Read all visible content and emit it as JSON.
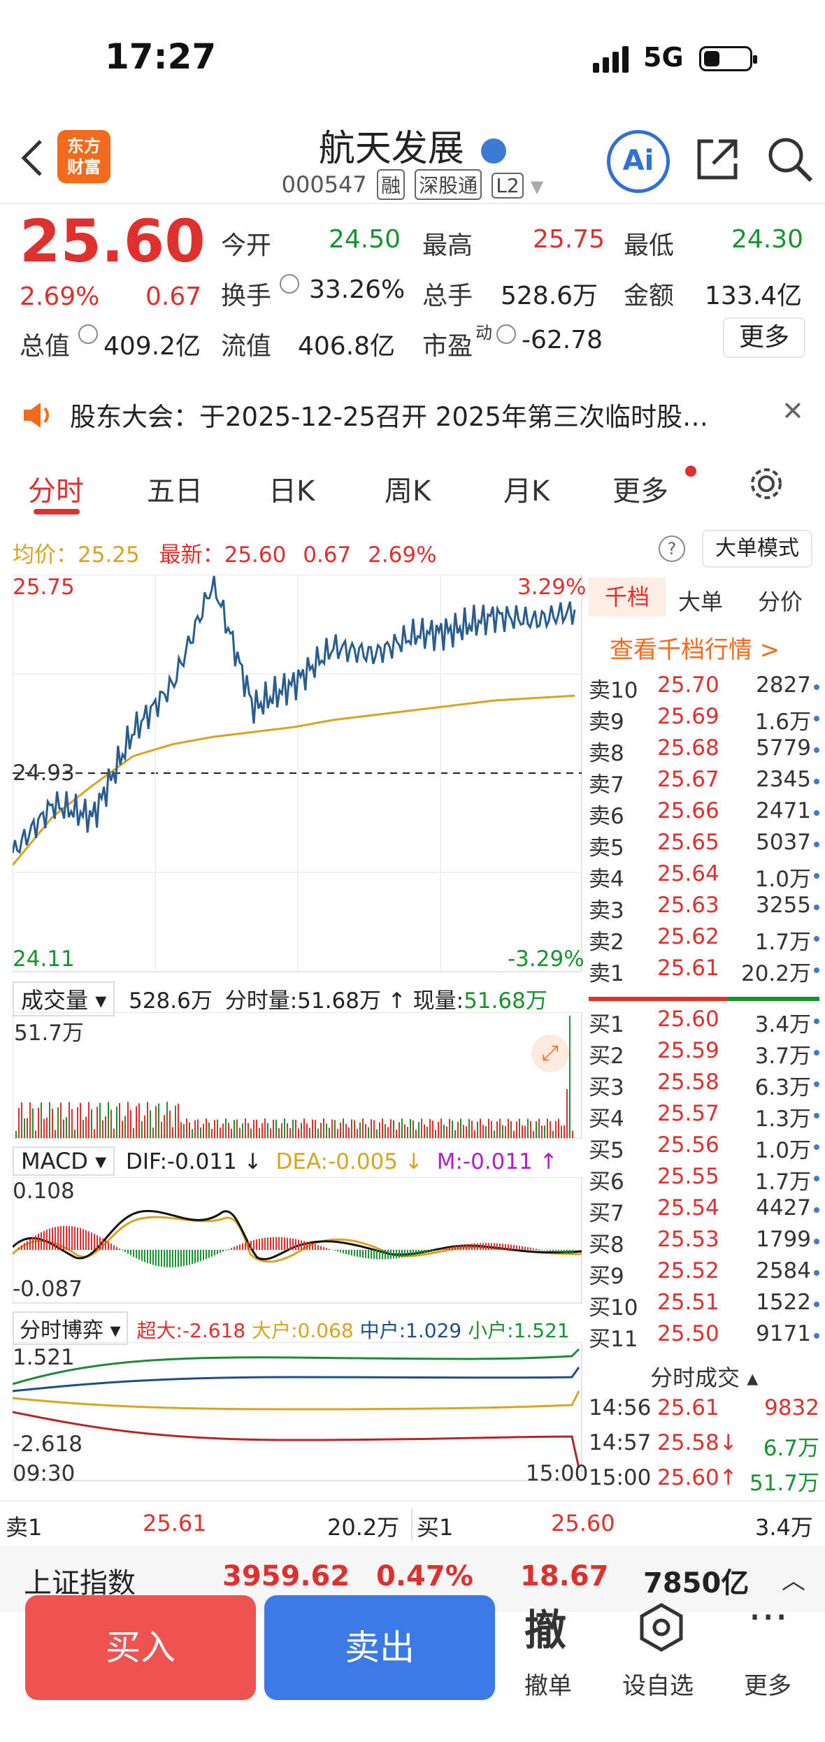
{
  "status": {
    "time": "17:27",
    "network": "5G"
  },
  "header": {
    "logo_line1": "东方",
    "logo_line2": "财富",
    "stock_name": "航天发展",
    "stock_code": "000547",
    "tags": [
      "融",
      "深股通",
      "L2"
    ],
    "ai_label": "Ai"
  },
  "quote": {
    "price": "25.60",
    "change_pct": "2.69%",
    "change": "0.67",
    "open_label": "今开",
    "open": "24.50",
    "high_label": "最高",
    "high": "25.75",
    "low_label": "最低",
    "low": "24.30",
    "turnover_label": "换手",
    "turnover": "33.26%",
    "volume_label": "总手",
    "volume": "528.6万",
    "amount_label": "金额",
    "amount": "133.4亿",
    "mktcap_label": "总值",
    "mktcap": "409.2亿",
    "float_label": "流值",
    "float_cap": "406.8亿",
    "pe_label": "市盈",
    "pe_sup": "动",
    "pe": "-62.78",
    "more_label": "更多"
  },
  "notice": {
    "text": "股东大会：于2025-12-25召开 2025年第三次临时股…"
  },
  "tabs": [
    "分时",
    "五日",
    "日K",
    "周K",
    "月K",
    "更多"
  ],
  "avg_line": {
    "avg_label": "均价：",
    "avg": "25.25",
    "latest_label": "最新：",
    "latest": "25.60",
    "latest_change": "0.67",
    "latest_pct": "2.69%",
    "big_order_mode": "大单模式"
  },
  "chart": {
    "y_top": "25.75",
    "y_mid": "24.93",
    "y_bottom": "24.11",
    "pct_top": "3.29%",
    "pct_bottom": "-3.29%",
    "volume_label": "成交量",
    "volume_total": "528.6万",
    "volume_time_label": "分时量:",
    "volume_time": "51.68万",
    "volume_now_label": "现量:",
    "volume_now": "51.68万",
    "volume_max": "51.7万",
    "macd_label": "MACD",
    "dif": "DIF:-0.011 ↓",
    "dea": "DEA:-0.005 ↓",
    "m": "M:-0.011 ↑",
    "macd_top": "0.108",
    "macd_bottom": "-0.087",
    "game_label": "分时博弈",
    "super": "超大:-2.618",
    "big": "大户:0.068",
    "mid": "中户:1.029",
    "small": "小户:1.521",
    "game_top": "1.521",
    "game_bottom": "-2.618",
    "time_start": "09:30",
    "time_end": "15:00"
  },
  "chart_data": {
    "type": "line",
    "title": "",
    "x": [
      "09:30",
      "15:00"
    ],
    "series": [
      {
        "name": "最新",
        "values": [
          24.6,
          24.8,
          24.75,
          25.1,
          25.3,
          25.72,
          25.2,
          25.3,
          25.45,
          25.42,
          25.5,
          25.52,
          25.58,
          25.56,
          25.6
        ]
      },
      {
        "name": "均价",
        "values": [
          24.55,
          24.75,
          24.88,
          25.0,
          25.05,
          25.08,
          25.1,
          25.12,
          25.15,
          25.17,
          25.19,
          25.21,
          25.23,
          25.24,
          25.25
        ]
      }
    ],
    "ylim": [
      24.11,
      25.75
    ]
  },
  "orderbook": {
    "tabs": [
      "千档",
      "大单",
      "分价"
    ],
    "link": "查看千档行情 >",
    "asks": [
      {
        "label": "卖10",
        "price": "25.70",
        "vol": "2827"
      },
      {
        "label": "卖9",
        "price": "25.69",
        "vol": "1.6万"
      },
      {
        "label": "卖8",
        "price": "25.68",
        "vol": "5779"
      },
      {
        "label": "卖7",
        "price": "25.67",
        "vol": "2345"
      },
      {
        "label": "卖6",
        "price": "25.66",
        "vol": "2471"
      },
      {
        "label": "卖5",
        "price": "25.65",
        "vol": "5037"
      },
      {
        "label": "卖4",
        "price": "25.64",
        "vol": "1.0万"
      },
      {
        "label": "卖3",
        "price": "25.63",
        "vol": "3255"
      },
      {
        "label": "卖2",
        "price": "25.62",
        "vol": "1.7万"
      },
      {
        "label": "卖1",
        "price": "25.61",
        "vol": "20.2万"
      }
    ],
    "bids": [
      {
        "label": "买1",
        "price": "25.60",
        "vol": "3.4万"
      },
      {
        "label": "买2",
        "price": "25.59",
        "vol": "3.7万"
      },
      {
        "label": "买3",
        "price": "25.58",
        "vol": "6.3万"
      },
      {
        "label": "买4",
        "price": "25.57",
        "vol": "1.3万"
      },
      {
        "label": "买5",
        "price": "25.56",
        "vol": "1.0万"
      },
      {
        "label": "买6",
        "price": "25.55",
        "vol": "1.7万"
      },
      {
        "label": "买7",
        "price": "25.54",
        "vol": "4427"
      },
      {
        "label": "买8",
        "price": "25.53",
        "vol": "1799"
      },
      {
        "label": "买9",
        "price": "25.52",
        "vol": "2584"
      },
      {
        "label": "买10",
        "price": "25.51",
        "vol": "1522"
      },
      {
        "label": "买11",
        "price": "25.50",
        "vol": "9171"
      }
    ],
    "trades_label": "分时成交",
    "trades": [
      {
        "time": "14:56",
        "price": "25.61",
        "vol": "9832"
      },
      {
        "time": "14:57",
        "price": "25.58↓",
        "vol": "6.7万"
      },
      {
        "time": "15:00",
        "price": "25.60↑",
        "vol": "51.7万"
      }
    ]
  },
  "bottom_quote": {
    "sell_label": "卖1",
    "sell_price": "25.61",
    "sell_vol": "20.2万",
    "buy_label": "买1",
    "buy_price": "25.60",
    "buy_vol": "3.4万"
  },
  "index_bar": {
    "name": "上证指数",
    "value": "3959.62",
    "pct": "0.47%",
    "change": "18.67",
    "amount": "7850亿"
  },
  "actions": {
    "buy": "买入",
    "sell": "卖出",
    "cancel_glyph": "撤",
    "cancel": "撤单",
    "watch": "设自选",
    "more": "更多"
  },
  "colors": {
    "up": "#e0302d",
    "down": "#17932f",
    "price_line": "#2a5d8f",
    "avg_line": "#d9a520",
    "accent": "#f26b1d"
  }
}
